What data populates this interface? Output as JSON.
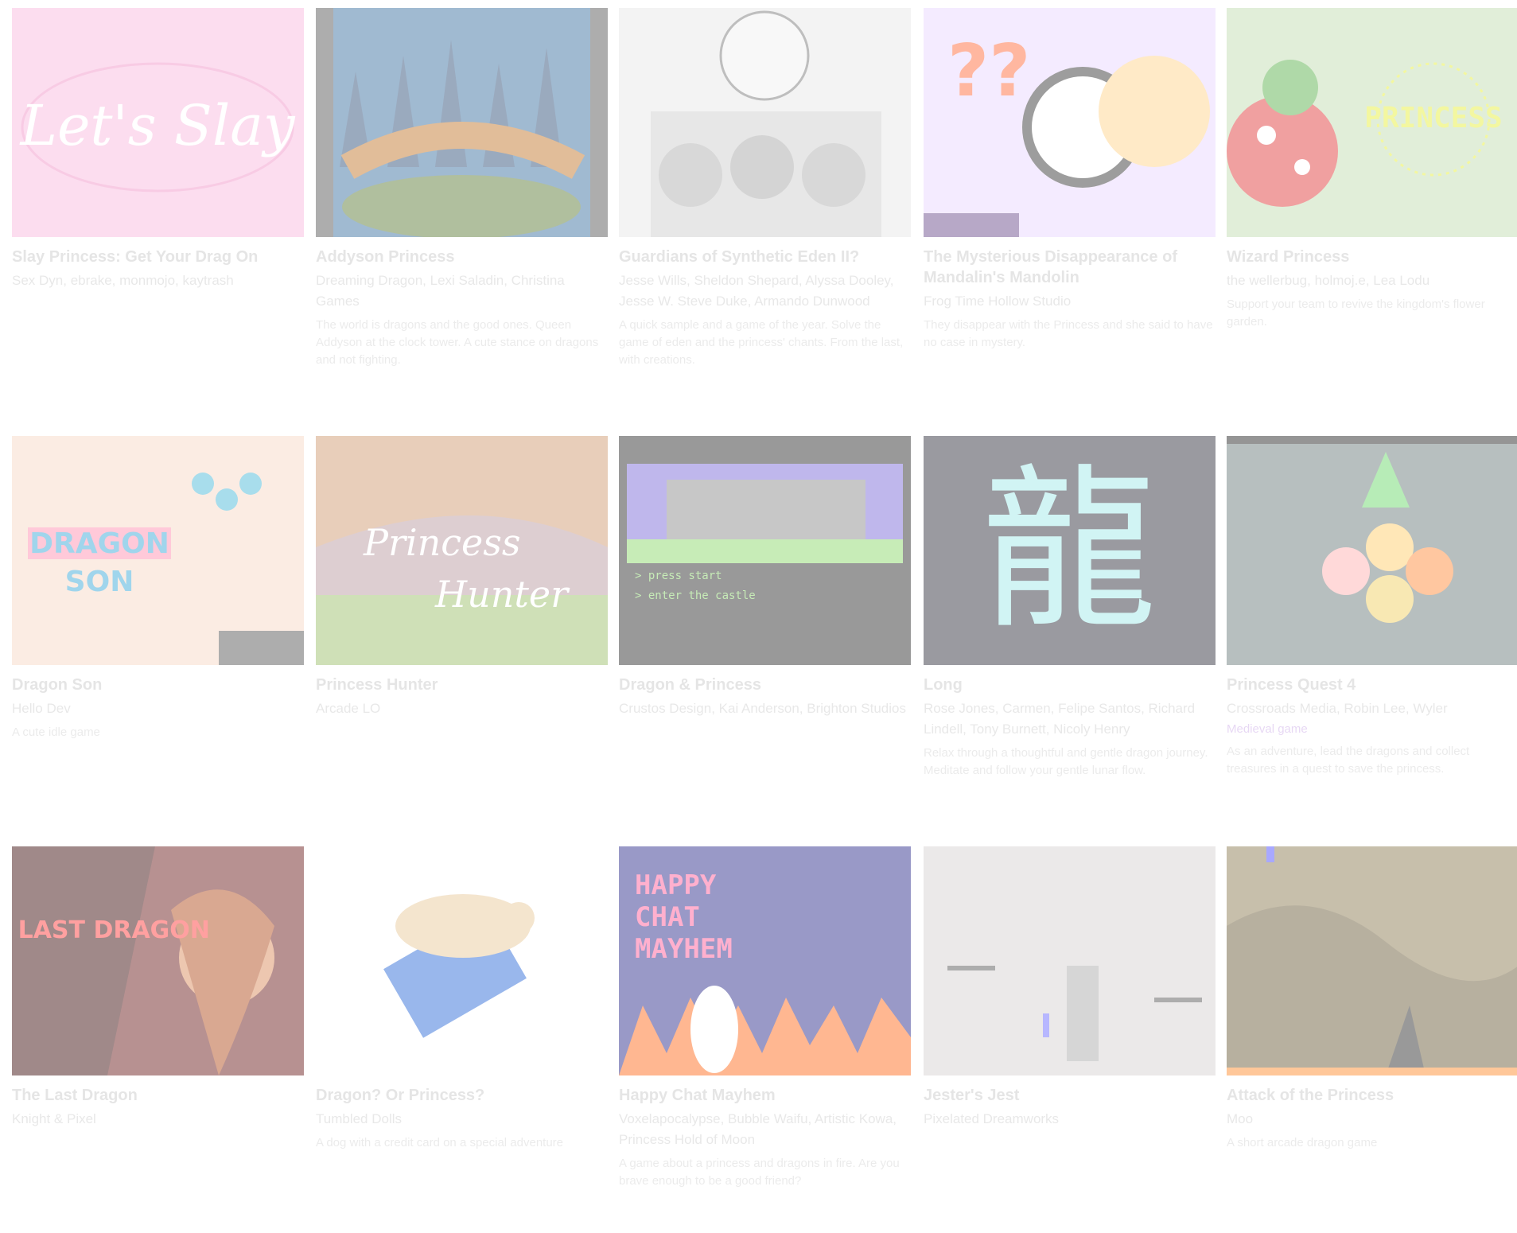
{
  "games": [
    {
      "title": "Slay Princess: Get Your Drag On",
      "author": "Sex Dyn, ebrake, monmojo, kaytrash",
      "tag": "",
      "desc": ""
    },
    {
      "title": "Addyson Princess",
      "author": "Dreaming Dragon, Lexi Saladin, Christina Games",
      "tag": "",
      "desc": "The world is dragons and the good ones. Queen Addyson at the clock tower. A cute stance on dragons and not fighting."
    },
    {
      "title": "Guardians of Synthetic Eden II?",
      "author": "Jesse Wills, Sheldon Shepard, Alyssa Dooley, Jesse W. Steve Duke, Armando Dunwood",
      "tag": "",
      "desc": "A quick sample and a game of the year. Solve the game of eden and the princess' chants. From the last, with creations."
    },
    {
      "title": "The Mysterious Disappearance of Mandalin's Mandolin",
      "author": "Frog Time Hollow Studio",
      "tag": "",
      "desc": "They disappear with the Princess and she said to have no case in mystery."
    },
    {
      "title": "Wizard Princess",
      "author": "the wellerbug, holmoj.e, Lea Lodu",
      "tag": "",
      "desc": "Support your team to revive the kingdom's flower garden."
    },
    {
      "title": "Dragon Son",
      "author": "Hello Dev",
      "tag": "",
      "desc": "A cute idle game"
    },
    {
      "title": "Princess Hunter",
      "author": "Arcade LO",
      "tag": "",
      "desc": ""
    },
    {
      "title": "Dragon & Princess",
      "author": "Crustos Design, Kai Anderson, Brighton Studios",
      "tag": "",
      "desc": ""
    },
    {
      "title": "Long",
      "author": "Rose Jones, Carmen, Felipe Santos, Richard Lindell, Tony Burnett, Nicoly Henry",
      "tag": "",
      "desc": "Relax through a thoughtful and gentle dragon journey. Meditate and follow your gentle lunar flow."
    },
    {
      "title": "Princess Quest 4",
      "author": "Crossroads Media, Robin Lee, Wyler",
      "tag": "Medieval game",
      "desc": "As an adventure, lead the dragons and collect treasures in a quest to save the princess."
    },
    {
      "title": "The Last Dragon",
      "author": "Knight & Pixel",
      "tag": "",
      "desc": ""
    },
    {
      "title": "Dragon? Or Princess?",
      "author": "Tumbled Dolls",
      "tag": "",
      "desc": "A dog with a credit card on a special adventure"
    },
    {
      "title": "Happy Chat Mayhem",
      "author": "Voxelapocalypse, Bubble Waifu, Artistic Kowa, Princess Hold of Moon",
      "tag": "",
      "desc": "A game about a princess and dragons in fire. Are you brave enough to be a good friend?"
    },
    {
      "title": "Jester's Jest",
      "author": "Pixelated Dreamworks",
      "tag": "",
      "desc": ""
    },
    {
      "title": "Attack of the Princess",
      "author": "Moo",
      "tag": "",
      "desc": "A short arcade dragon game"
    }
  ]
}
